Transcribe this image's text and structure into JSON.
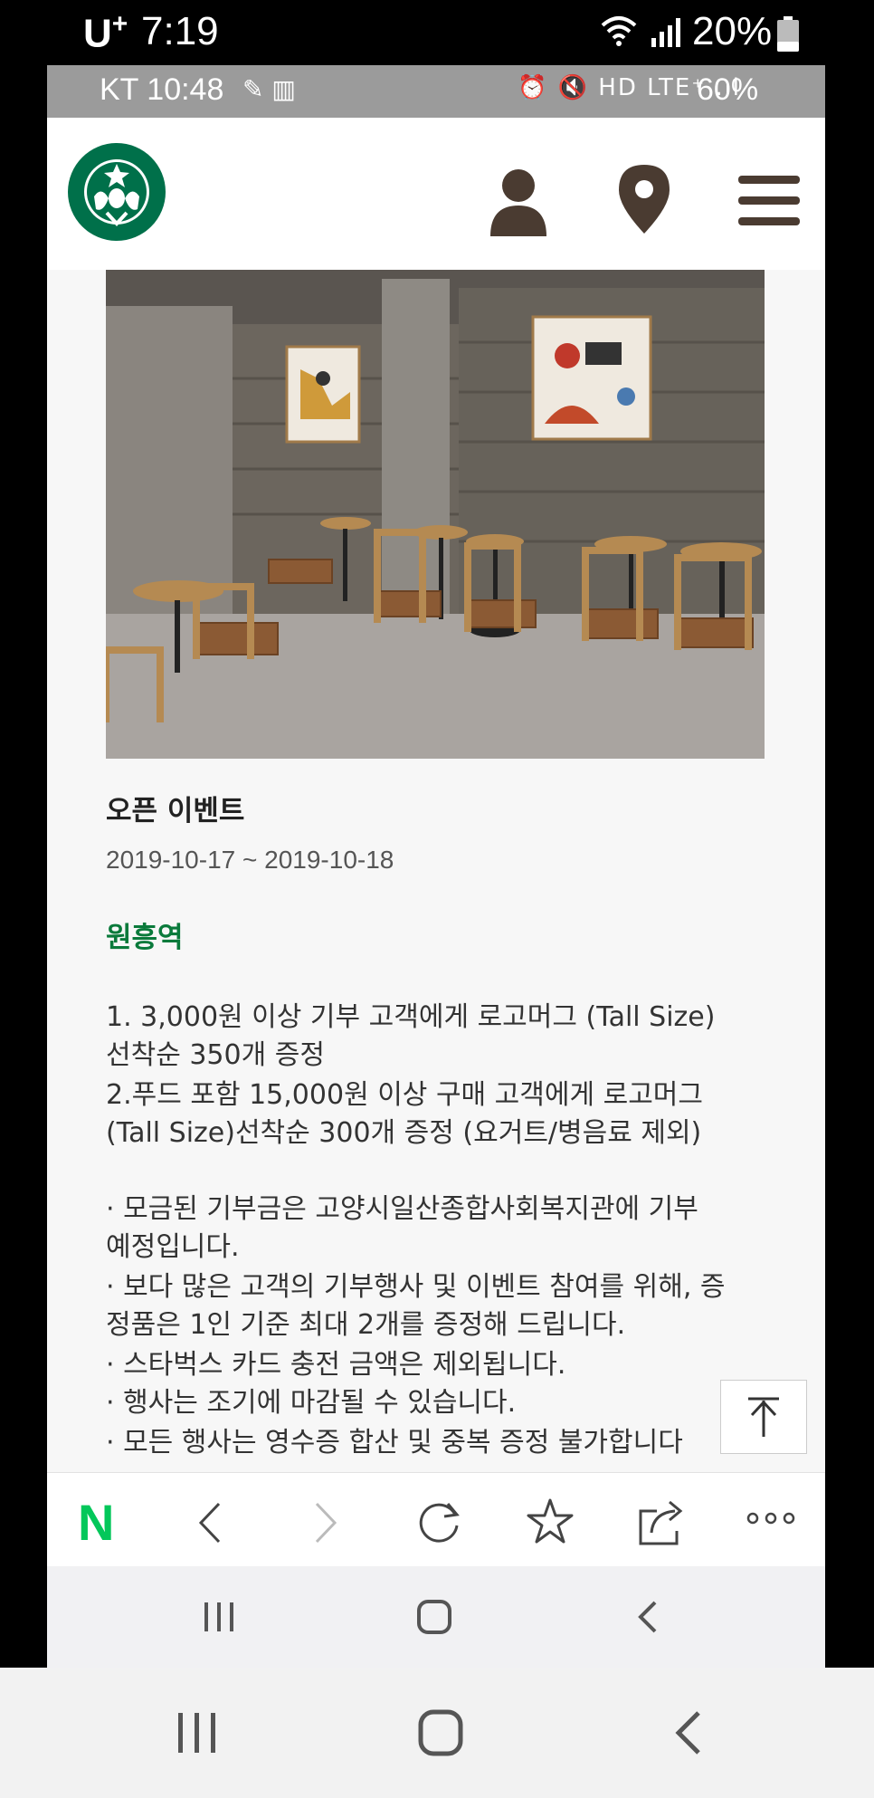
{
  "outer_status": {
    "carrier": "U",
    "carrier_sup": "+",
    "time": "7:19",
    "battery": "20%"
  },
  "inner_status": {
    "carrier_time": "KT 10:48",
    "battery": "60%",
    "icons_left": "✎ ▥",
    "icons_right": "⏰ 🔇 HD LTE⁺ .ıl"
  },
  "header": {
    "logo": "starbucks-logo",
    "icons": [
      "user-icon",
      "location-pin-icon",
      "menu-icon"
    ]
  },
  "event": {
    "title": "오픈 이벤트",
    "dates": "2019-10-17 ~ 2019-10-18",
    "store": "원흥역",
    "body_lines": [
      "1. 3,000원 이상 기부 고객에게 로고머그 (Tall Size)",
      "선착순 350개 증정",
      "2.푸드 포함 15,000원 이상 구매 고객에게 로고머그",
      "(Tall Size)선착순 300개 증정 (요거트/병음료 제외)",
      "",
      "· 모금된 기부금은 고양시일산종합사회복지관에 기부",
      "예정입니다.",
      "· 보다 많은 고객의 기부행사 및 이벤트 참여를 위해, 증",
      "정품은 1인 기준 최대 2개를 증정해 드립니다.",
      "· 스타벅스 카드 충전 금액은 제외됩니다.",
      "· 행사는 조기에 마감될 수 있습니다.",
      "· 모든 행사는 영수증 합산 및 중복 증정 불가합니다"
    ]
  },
  "browser": {
    "home_label": "N",
    "colors": {
      "naver_green": "#03c75a",
      "starbucks_green": "#00704a",
      "brown": "#4a3b31"
    }
  }
}
